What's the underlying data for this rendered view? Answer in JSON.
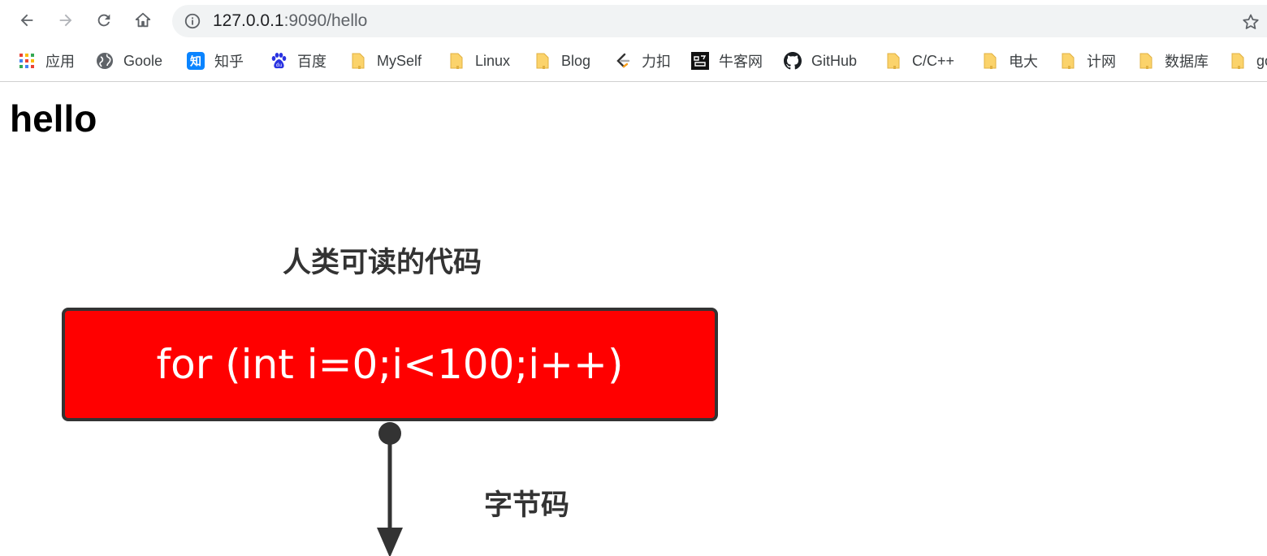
{
  "browser": {
    "url_host": "127.0.0.1",
    "url_path": ":9090/hello",
    "nav": {
      "back_icon": "back-arrow-icon",
      "forward_icon": "forward-arrow-icon",
      "reload_icon": "reload-icon",
      "home_icon": "home-icon"
    }
  },
  "bookmarks": [
    {
      "label": "应用",
      "icon": "apps-grid-icon"
    },
    {
      "label": "Goole",
      "icon": "globe-icon"
    },
    {
      "label": "知乎",
      "icon": "zhihu-icon"
    },
    {
      "label": "百度",
      "icon": "baidu-paw-icon"
    },
    {
      "label": "MySelf",
      "icon": "folder-icon"
    },
    {
      "label": "Linux",
      "icon": "folder-icon"
    },
    {
      "label": "Blog",
      "icon": "folder-icon"
    },
    {
      "label": "力扣",
      "icon": "leetcode-icon"
    },
    {
      "label": "牛客网",
      "icon": "nowcoder-icon"
    },
    {
      "label": "GitHub",
      "icon": "github-icon"
    },
    {
      "label": "C/C++",
      "icon": "folder-icon"
    },
    {
      "label": "电大",
      "icon": "folder-icon"
    },
    {
      "label": "计网",
      "icon": "folder-icon"
    },
    {
      "label": "数据库",
      "icon": "folder-icon"
    },
    {
      "label": "go",
      "icon": "folder-icon"
    }
  ],
  "page": {
    "heading": "hello",
    "figure": {
      "top_label": "人类可读的代码",
      "code": "for (int i=0;i<100;i++)",
      "arrow_label": "字节码"
    }
  },
  "colors": {
    "code_box": "#ff0000",
    "folder": "#fbd36b",
    "zhihu": "#0a84ff",
    "baidu": "#2932e1"
  }
}
